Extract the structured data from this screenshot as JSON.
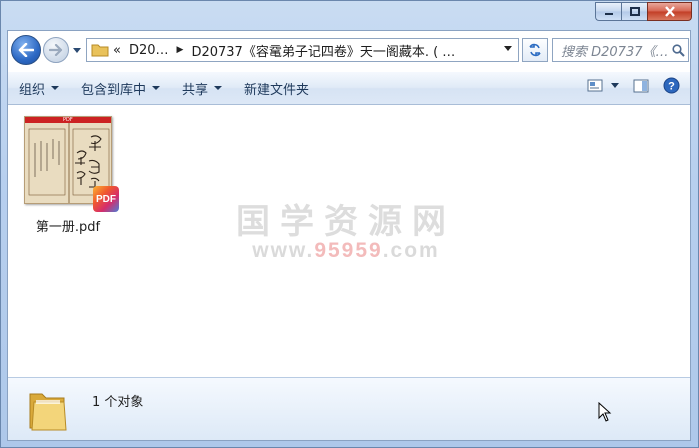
{
  "address": {
    "overflow": "«",
    "seg1": "D20…",
    "seg2": "D20737《容鼋弟子记四卷》天一阁藏本. ( …"
  },
  "search": {
    "placeholder": "搜索 D20737《…"
  },
  "toolbar": {
    "organize": "组织",
    "include_in_library": "包含到库中",
    "share": "共享",
    "new_folder": "新建文件夹"
  },
  "file": {
    "name": "第一册.pdf",
    "badge": "PDF",
    "thumb_header": "PDF"
  },
  "watermark": {
    "title": "国学资源网",
    "url_pre": "www.",
    "url_num": "95959",
    "url_post": ".com"
  },
  "details": {
    "count": "1 个对象"
  },
  "colors": {
    "toolbar_text": "#1e395b",
    "frame": "#b7cfee",
    "badge_red": "#f05a2e"
  }
}
